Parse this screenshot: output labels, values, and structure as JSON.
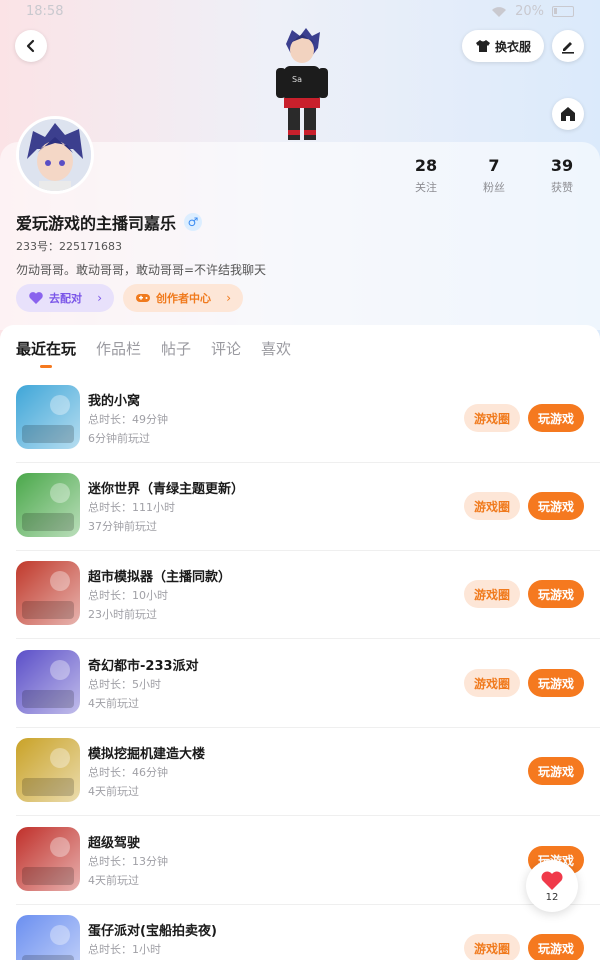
{
  "status_bar": {
    "time": "18:58",
    "battery": "20%"
  },
  "header": {
    "dress_label": "换衣服"
  },
  "profile": {
    "name": "爱玩游戏的主播司嘉乐",
    "gender_symbol": "♂",
    "uid": "233号：225171683",
    "bio": "勿动哥哥。敢动哥哥，敢动哥哥=不许结我聊天",
    "match_label": "去配对",
    "creator_label": "创作者中心"
  },
  "stats": [
    {
      "value": "28",
      "label": "关注"
    },
    {
      "value": "7",
      "label": "粉丝"
    },
    {
      "value": "39",
      "label": "获赞"
    }
  ],
  "tabs": [
    "最近在玩",
    "作品栏",
    "帖子",
    "评论",
    "喜欢"
  ],
  "buttons": {
    "circle": "游戏圈",
    "play": "玩游戏"
  },
  "games": [
    {
      "title": "我的小窝",
      "duration": "总时长：49分钟",
      "played": "6分钟前玩过",
      "has_circle": true,
      "color": "#3fa6d8"
    },
    {
      "title": "迷你世界（青绿主题更新）",
      "duration": "总时长：111小时",
      "played": "37分钟前玩过",
      "has_circle": true,
      "color": "#4aa84a"
    },
    {
      "title": "超市模拟器（主播同款）",
      "duration": "总时长：10小时",
      "played": "23小时前玩过",
      "has_circle": true,
      "color": "#c0392b"
    },
    {
      "title": "奇幻都市-233派对",
      "duration": "总时长：5小时",
      "played": "4天前玩过",
      "has_circle": true,
      "color": "#5b4fc8"
    },
    {
      "title": "模拟挖掘机建造大楼",
      "duration": "总时长：46分钟",
      "played": "4天前玩过",
      "has_circle": false,
      "color": "#c9a227"
    },
    {
      "title": "超级驾驶",
      "duration": "总时长：13分钟",
      "played": "4天前玩过",
      "has_circle": false,
      "color": "#c0302a"
    },
    {
      "title": "蛋仔派对(宝船拍卖夜)",
      "duration": "总时长：1小时",
      "played": "",
      "has_circle": true,
      "color": "#6b8ff0"
    }
  ],
  "like_float": {
    "count": "12"
  }
}
